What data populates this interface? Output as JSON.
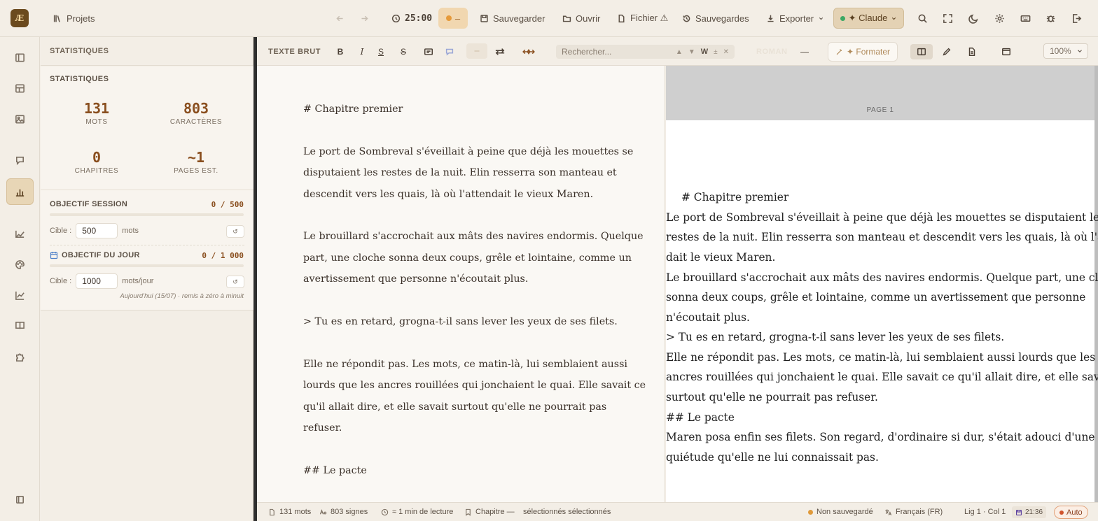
{
  "app": {
    "logo": "Æ",
    "projects_label": "Projets",
    "timer": "25:00",
    "pomodoro_label": "–",
    "save_label": "Sauvegarder",
    "open_label": "Ouvrir",
    "file_label": "Fichier ⚠",
    "backups_label": "Sauvegardes",
    "export_label": "Exporter",
    "ai_label": "✦ Claude"
  },
  "panel": {
    "header": "STATISTIQUES",
    "card_title": "STATISTIQUES",
    "stats": [
      {
        "value": "131",
        "label": "MOTS"
      },
      {
        "value": "803",
        "label": "CARACTÈRES"
      },
      {
        "value": "0",
        "label": "CHAPITRES"
      },
      {
        "value": "~1",
        "label": "PAGES EST."
      }
    ],
    "session": {
      "title": "OBJECTIF SESSION",
      "count": "0 / 500",
      "progress": 0,
      "target_label": "Cible :",
      "target_value": "500",
      "unit": "mots",
      "reset": "↺"
    },
    "daily": {
      "title": "OBJECTIF DU JOUR",
      "count": "0 / 1 000",
      "progress": 0,
      "target_label": "Cible :",
      "target_value": "1000",
      "unit": "mots/jour",
      "reset": "↺",
      "note": "Aujourd'hui (15/07) · remis à zéro à minuit"
    }
  },
  "editor_toolbar": {
    "mode": "TEXTE BRUT",
    "bold": "B",
    "italic": "I",
    "underline": "S",
    "strike": "S",
    "search_placeholder": "Rechercher...",
    "search_whole_word": "W",
    "search_case": "±",
    "roman_label": "ROMAN",
    "dash_label": "—",
    "format_label": "✦ Formater",
    "zoom": "100%"
  },
  "source_lines": [
    "# Chapitre premier",
    "",
    "Le port de Sombreval s'éveillait à peine que déjà les mouettes se",
    "disputaient les restes de la nuit. Elin resserra son manteau et",
    "descendit vers les quais, là où l'attendait le vieux Maren.",
    "",
    "Le brouillard s'accrochait aux mâts des navires endormis. Quelque",
    "part, une cloche sonna deux coups, grêle et lointaine, comme un",
    "avertissement que personne n'écoutait plus.",
    "",
    "> Tu es en retard, grogna-t-il sans lever les yeux de ses filets.",
    "",
    "Elle ne répondit pas. Les mots, ce matin-là, lui semblaient aussi",
    "lourds que les ancres rouillées qui jonchaient le quai. Elle savait ce",
    "qu'il allait dire, et elle savait surtout qu'elle ne pourrait pas",
    "refuser.",
    "",
    "## Le pacte"
  ],
  "preview": {
    "page_label": "PAGE 1",
    "lines": [
      "# Chapitre premier",
      "Le port de Sombreval s'éveillait à peine que déjà les mouettes se disputaient les",
      "restes de la nuit. Elin resserra son manteau et descendit vers les quais, là où l'atten-",
      "dait le vieux Maren.",
      "Le brouillard s'accrochait aux mâts des navires endormis. Quelque part, une cloche",
      "sonna deux coups, grêle et lointaine, comme un avertissement que personne",
      "n'écoutait plus.",
      "> Tu es en retard, grogna-t-il sans lever les yeux de ses filets.",
      "Elle ne répondit pas. Les mots, ce matin-là, lui semblaient aussi lourds que les",
      "ancres rouillées qui jonchaient le quai. Elle savait ce qu'il allait dire, et elle savait",
      "surtout qu'elle ne pourrait pas refuser.",
      "## Le pacte",
      "Maren posa enfin ses filets. Son regard, d'ordinaire si dur, s'était adouci d'une",
      "quiétude qu'elle ne lui connaissait pas."
    ]
  },
  "status": {
    "words": "131 mots",
    "signs": "803 signes",
    "reading": "≈ 1 min de lecture",
    "chapter": "Chapitre —",
    "selection": "sélectionnés  sélectionnés",
    "save_state": "Non sauvegardé",
    "language": "Français (FR)",
    "position": "Lig 1 · Col 1",
    "time": "21:36",
    "auto": "Auto"
  },
  "colors": {
    "accent": "#8a4f1f",
    "background": "#f3eee6",
    "active_rail": "#e8d6b6",
    "divider": "#2e2e2e"
  }
}
